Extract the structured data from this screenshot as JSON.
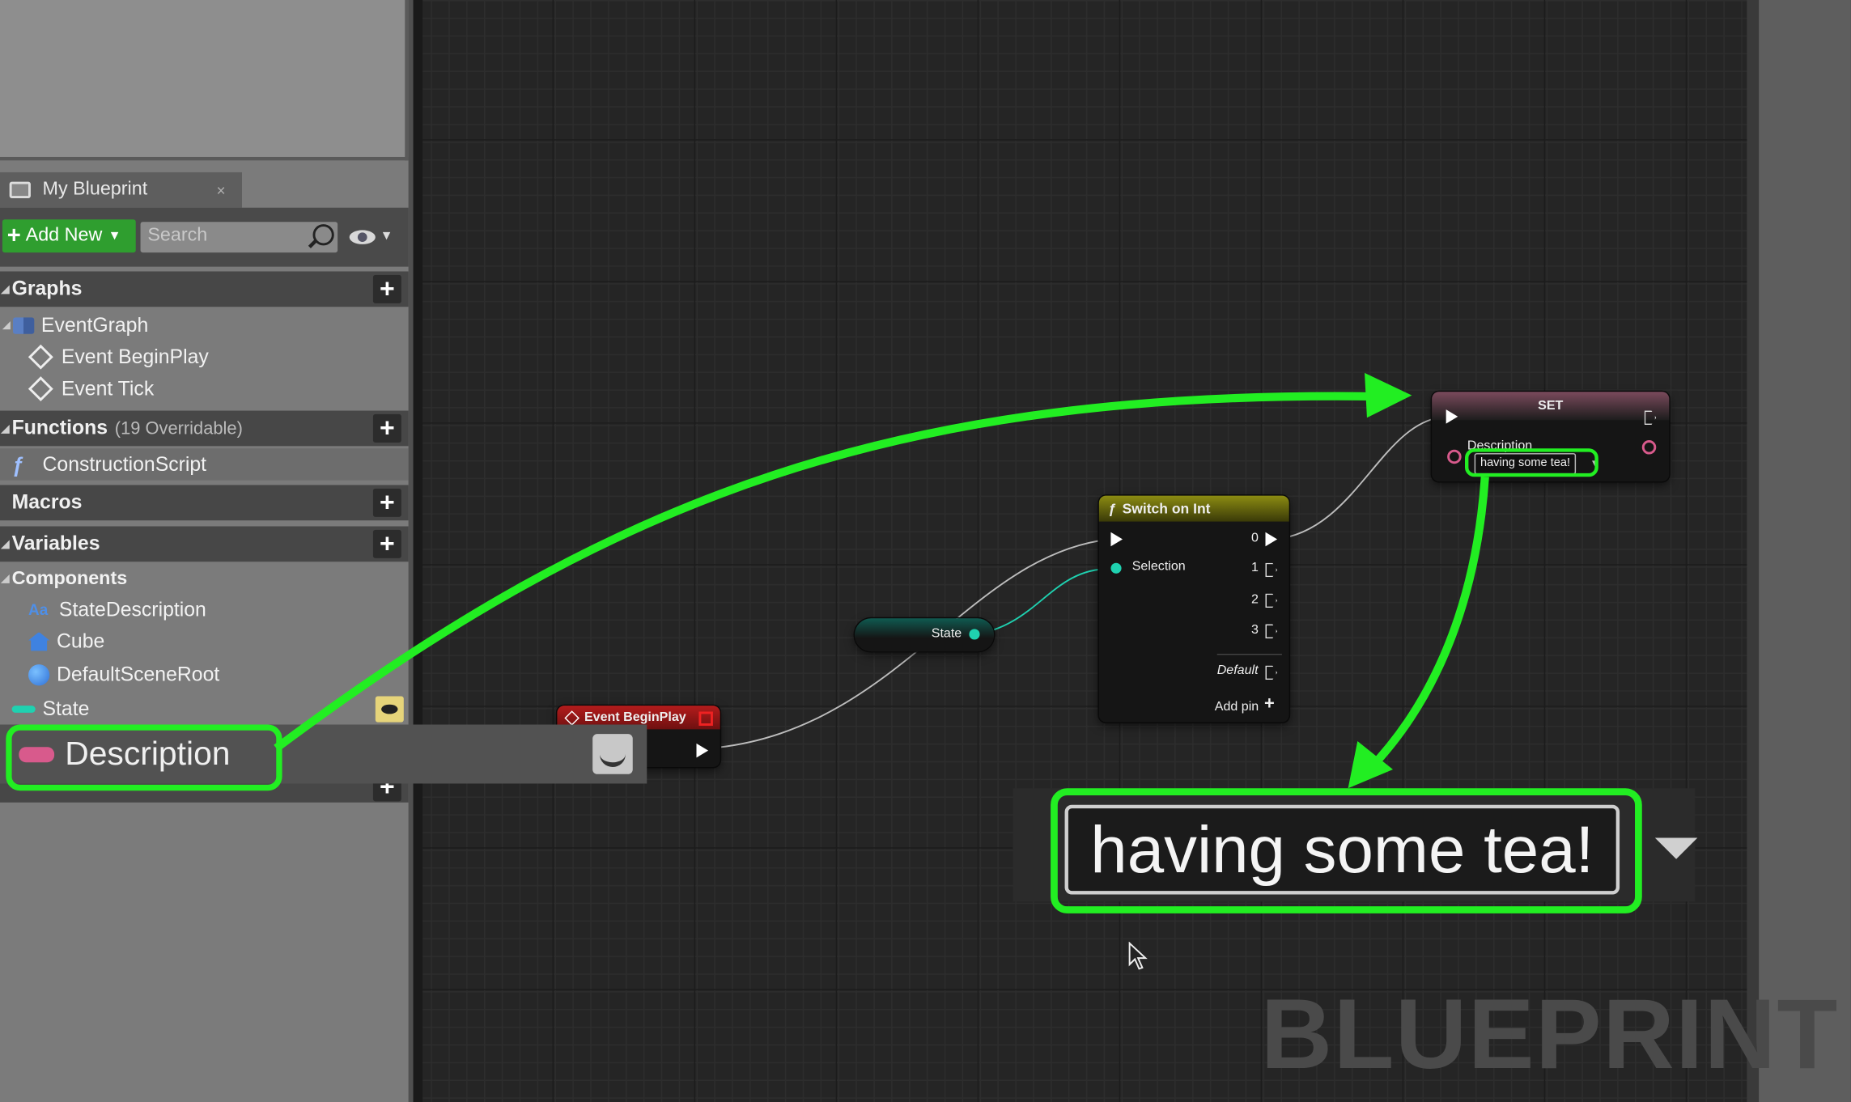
{
  "panel": {
    "tab_title": "My Blueprint",
    "tab_close": "×",
    "add_new": "Add New",
    "search_placeholder": "Search",
    "sections": {
      "graphs": "Graphs",
      "functions": "Functions",
      "functions_sub": "(19 Overridable)",
      "macros": "Macros",
      "variables": "Variables",
      "components": "Components"
    },
    "graph_items": [
      "EventGraph",
      "Event BeginPlay",
      "Event Tick"
    ],
    "function_items": [
      "ConstructionScript"
    ],
    "component_items": [
      "StateDescription",
      "Cube",
      "DefaultSceneRoot"
    ],
    "variables": [
      "State",
      "Description"
    ]
  },
  "graph": {
    "watermark": "BLUEPRINT",
    "nodes": {
      "event_beginplay": "Event BeginPlay",
      "state_getter": "State",
      "switch_title": "Switch on Int",
      "switch_selection": "Selection",
      "switch_outputs": [
        "0",
        "1",
        "2",
        "3"
      ],
      "switch_default": "Default",
      "switch_add_pin": "Add pin",
      "set_title": "SET",
      "set_pin": "Description",
      "set_value": "having some tea!"
    },
    "zoom_value": "having some tea!"
  },
  "colors": {
    "highlight": "#22ee22",
    "string_pin": "#d85a8c",
    "int_pin": "#1fd1b0",
    "accent_add": "#2f9e2f"
  }
}
